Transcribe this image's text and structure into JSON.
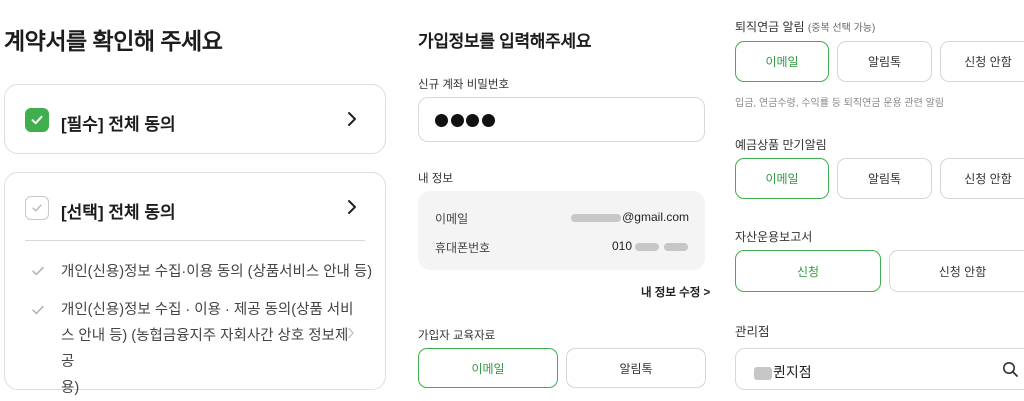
{
  "left": {
    "title": "계약서를 확인해 주세요",
    "required": {
      "label": "[필수] 전체 동의"
    },
    "optional": {
      "label": "[선택] 전체 동의",
      "items": [
        {
          "line1": "개인(신용)정보 수집·이용 동의 (상품서비스 안내 등)"
        },
        {
          "line1": "개인(신용)정보 수집 · 이용 · 제공 동의(상품 서비",
          "line2": "스 안내 등) (농협금융지주 자회사간 상호 정보제공",
          "line3": "용)"
        }
      ]
    }
  },
  "middle": {
    "title": "가입정보를 입력해주세요",
    "password": {
      "label": "신규 계좌 비밀번호",
      "masked_count": 4
    },
    "my_info": {
      "label": "내 정보",
      "email_label": "이메일",
      "email_value": "@gmail.com",
      "phone_label": "휴대폰번호",
      "phone_value": "010",
      "edit_link": "내 정보 수정 >"
    },
    "education": {
      "label": "가입자 교육자료",
      "options": [
        "이메일",
        "알림톡"
      ]
    }
  },
  "right": {
    "pension_alert": {
      "label": "퇴직연금 알림",
      "note": "(중복 선택 가능)",
      "options": [
        "이메일",
        "알림톡",
        "신청 안함"
      ],
      "hint": "입금, 연금수령, 수익률 등 퇴직연금 운용 관련 알림"
    },
    "deposit_alert": {
      "label": "예금상품 만기알림",
      "options": [
        "이메일",
        "알림톡",
        "신청 안함"
      ]
    },
    "asset_report": {
      "label": "자산운용보고서",
      "options": [
        "신청",
        "신청 안함"
      ]
    },
    "branch": {
      "label": "관리점",
      "value": "퀸지점"
    }
  },
  "colors": {
    "accent": "#3fae4f",
    "border": "#d6d6d6",
    "panel": "#f4f4f4"
  }
}
